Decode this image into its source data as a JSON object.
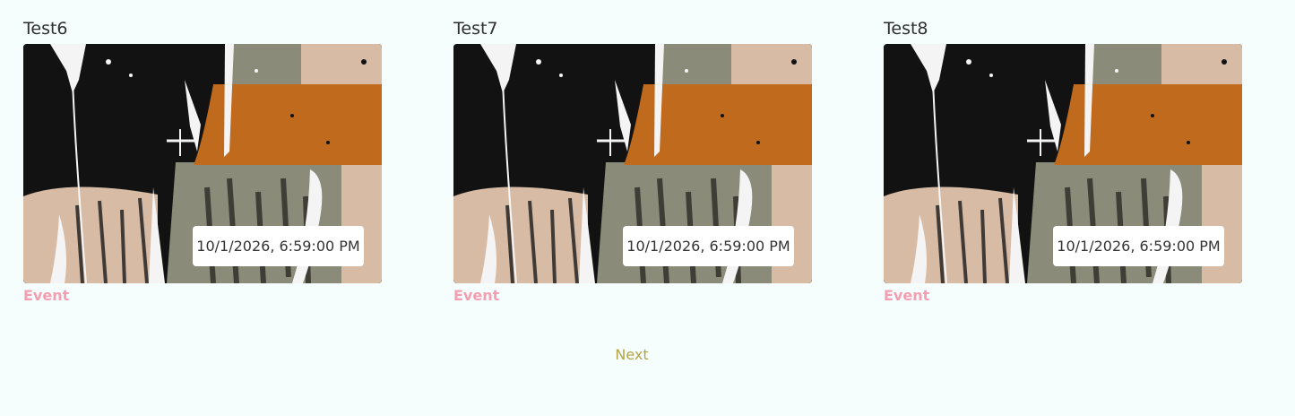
{
  "cards": [
    {
      "title": "Test6",
      "date": "10/1/2026, 6:59:00 PM",
      "tag": "Event"
    },
    {
      "title": "Test7",
      "date": "10/1/2026, 6:59:00 PM",
      "tag": "Event"
    },
    {
      "title": "Test8",
      "date": "10/1/2026, 6:59:00 PM",
      "tag": "Event"
    }
  ],
  "pagination": {
    "next_label": "Next"
  },
  "colors": {
    "background": "#f5fdfd",
    "tag": "#f2a0b1",
    "next": "#b2a54a",
    "paint_black": "#121212",
    "paint_orange": "#c06a1d",
    "paint_sage": "#8a8b78",
    "paint_beige": "#d7bba4"
  }
}
